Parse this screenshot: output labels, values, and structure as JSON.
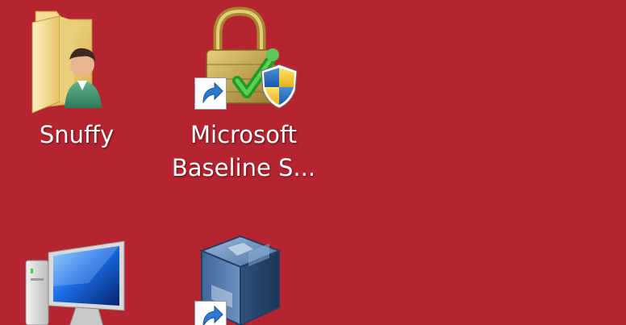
{
  "desktop": {
    "background_color": "#b62431",
    "icons": [
      {
        "label": "Snuffy",
        "icon": "user-folder-icon",
        "shortcut": false
      },
      {
        "label_line1": "Microsoft",
        "label_line2": "Baseline S...",
        "icon": "padlock-security-icon",
        "shortcut": true
      },
      {
        "label": "",
        "icon": "computer-monitor-icon",
        "shortcut": false
      },
      {
        "label": "",
        "icon": "virtualbox-icon",
        "shortcut": true
      }
    ]
  }
}
